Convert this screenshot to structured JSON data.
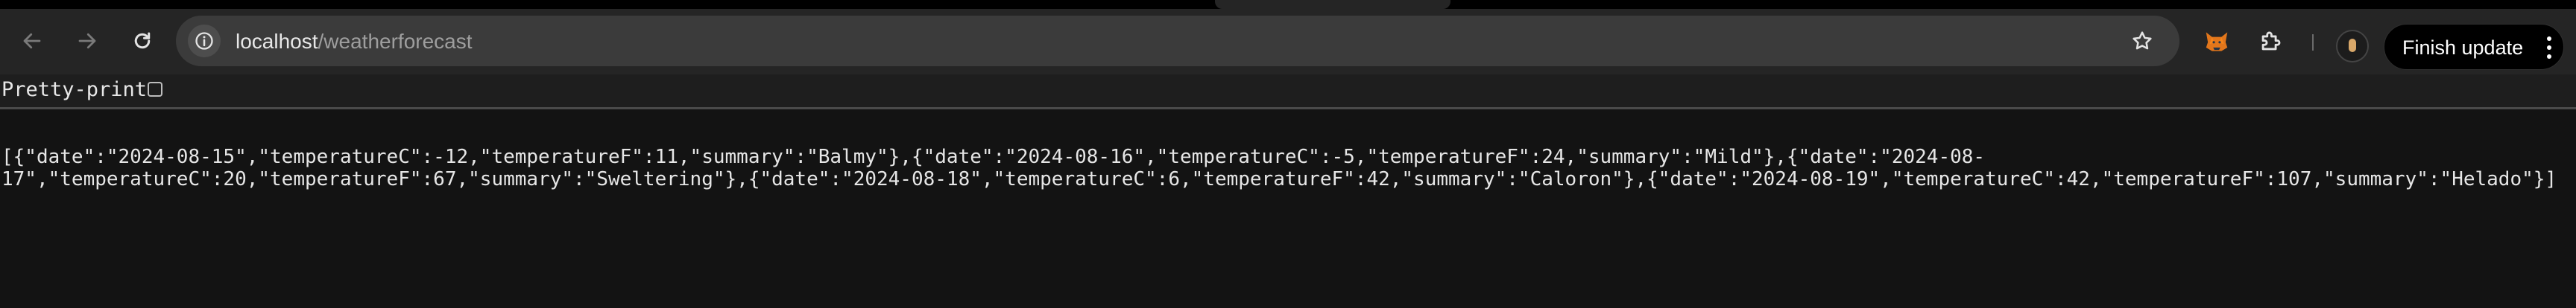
{
  "browser": {
    "url_host": "localhost",
    "url_path": "/weatherforecast",
    "update_button_label": "Finish update",
    "icons": {
      "back": "arrow-left-icon",
      "forward": "arrow-right-icon",
      "reload": "reload-icon",
      "site_info": "site-info-icon",
      "bookmark": "star-icon",
      "extension_fox": "fox-extension-icon",
      "extensions": "puzzle-icon",
      "menu": "kebab-icon"
    }
  },
  "page": {
    "pretty_print_label": "Pretty-print",
    "pretty_print_checked": false,
    "json_line_1": "[{\"date\":\"2024-08-15\",\"temperatureC\":-12,\"temperatureF\":11,\"summary\":\"Balmy\"},{\"date\":\"2024-08-16\",\"temperatureC\":-5,\"temperatureF\":24,\"summary\":\"Mild\"},{\"date\":\"2024-08-",
    "json_line_2": "17\",\"temperatureC\":20,\"temperatureF\":67,\"summary\":\"Sweltering\"},{\"date\":\"2024-08-18\",\"temperatureC\":6,\"temperatureF\":42,\"summary\":\"Caloron\"},{\"date\":\"2024-08-19\",\"temperatureC\":42,\"temperatureF\":107,\"summary\":\"Helado\"}]"
  }
}
